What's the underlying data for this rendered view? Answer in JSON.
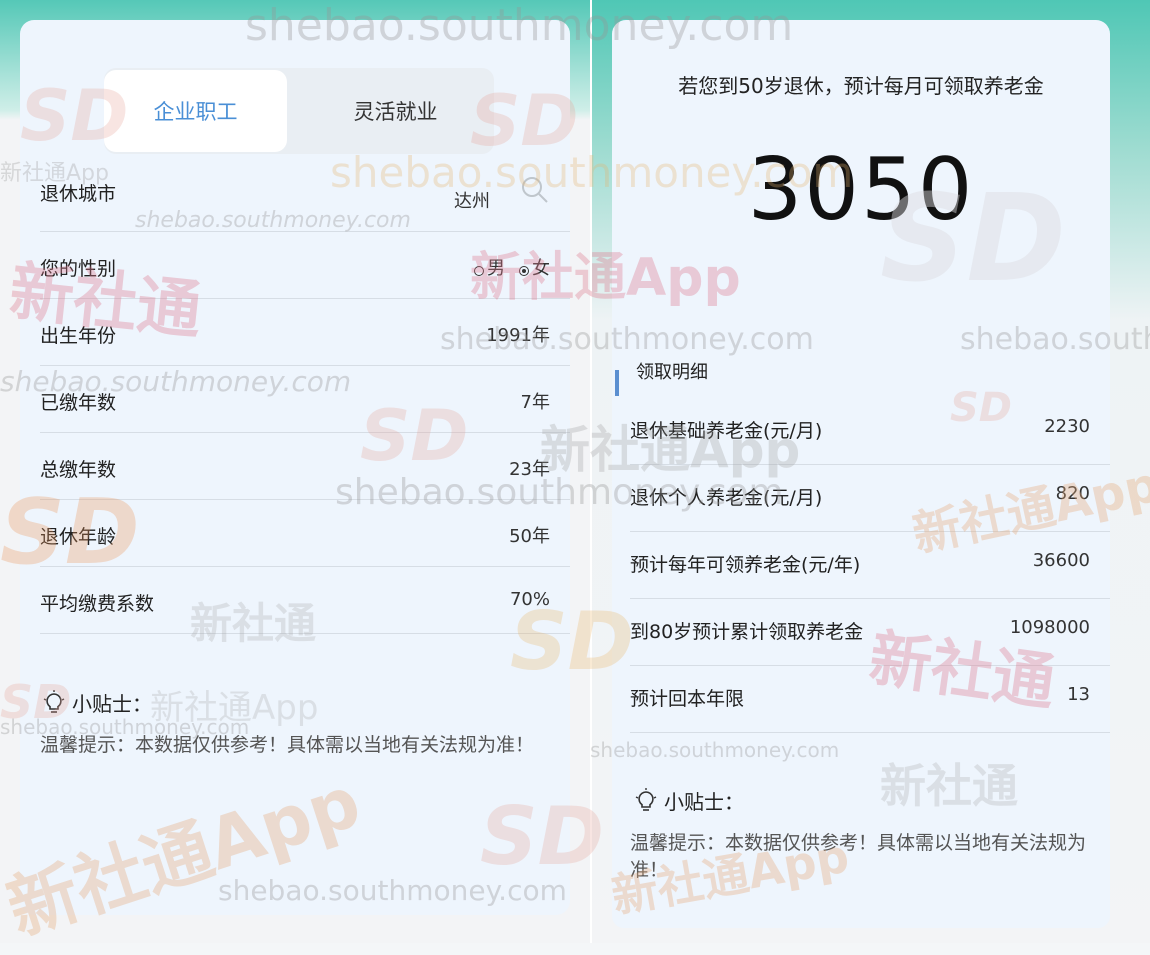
{
  "tabs": {
    "active": "企业职工",
    "inactive": "灵活就业"
  },
  "form": {
    "city_label": "退休城市",
    "city_value": "达州",
    "gender_label": "您的性别",
    "gender_male": "男",
    "gender_female": "女",
    "gender_selected": "女",
    "birth_year_label": "出生年份",
    "birth_year_value": "1991年",
    "paid_years_label": "已缴年数",
    "paid_years_value": "7年",
    "total_years_label": "总缴年数",
    "total_years_value": "23年",
    "retire_age_label": "退休年龄",
    "retire_age_value": "50年",
    "avg_coef_label": "平均缴费系数",
    "avg_coef_value": "70%"
  },
  "left_tip": {
    "title": "小贴士：",
    "text": "温馨提示：本数据仅供参考！具体需以当地有关法规为准！"
  },
  "result": {
    "headline": "若您到50岁退休，预计每月可领取养老金",
    "amount": "3050"
  },
  "details": {
    "title": "领取明细",
    "rows": [
      {
        "label": "退休基础养老金(元/月)",
        "value": "2230"
      },
      {
        "label": "退休个人养老金(元/月)",
        "value": "820"
      },
      {
        "label": "预计每年可领养老金(元/年)",
        "value": "36600"
      },
      {
        "label": "到80岁预计累计领取养老金",
        "value": "1098000"
      },
      {
        "label": "预计回本年限",
        "value": "13"
      }
    ]
  },
  "right_tip": {
    "title": "小贴士：",
    "text": "温馨提示：本数据仅供参考！具体需以当地有关法规为准！"
  },
  "watermarks": {
    "url": "shebao.southmoney.com",
    "app": "新社通App",
    "brand": "新社通",
    "logo": "SD"
  },
  "colors": {
    "accent": "#4a8fd6",
    "header_teal": "#4fc7b5",
    "card_bg": "#eef5fd"
  },
  "icons": {
    "search": "search-icon",
    "tip": "lightbulb-icon"
  }
}
